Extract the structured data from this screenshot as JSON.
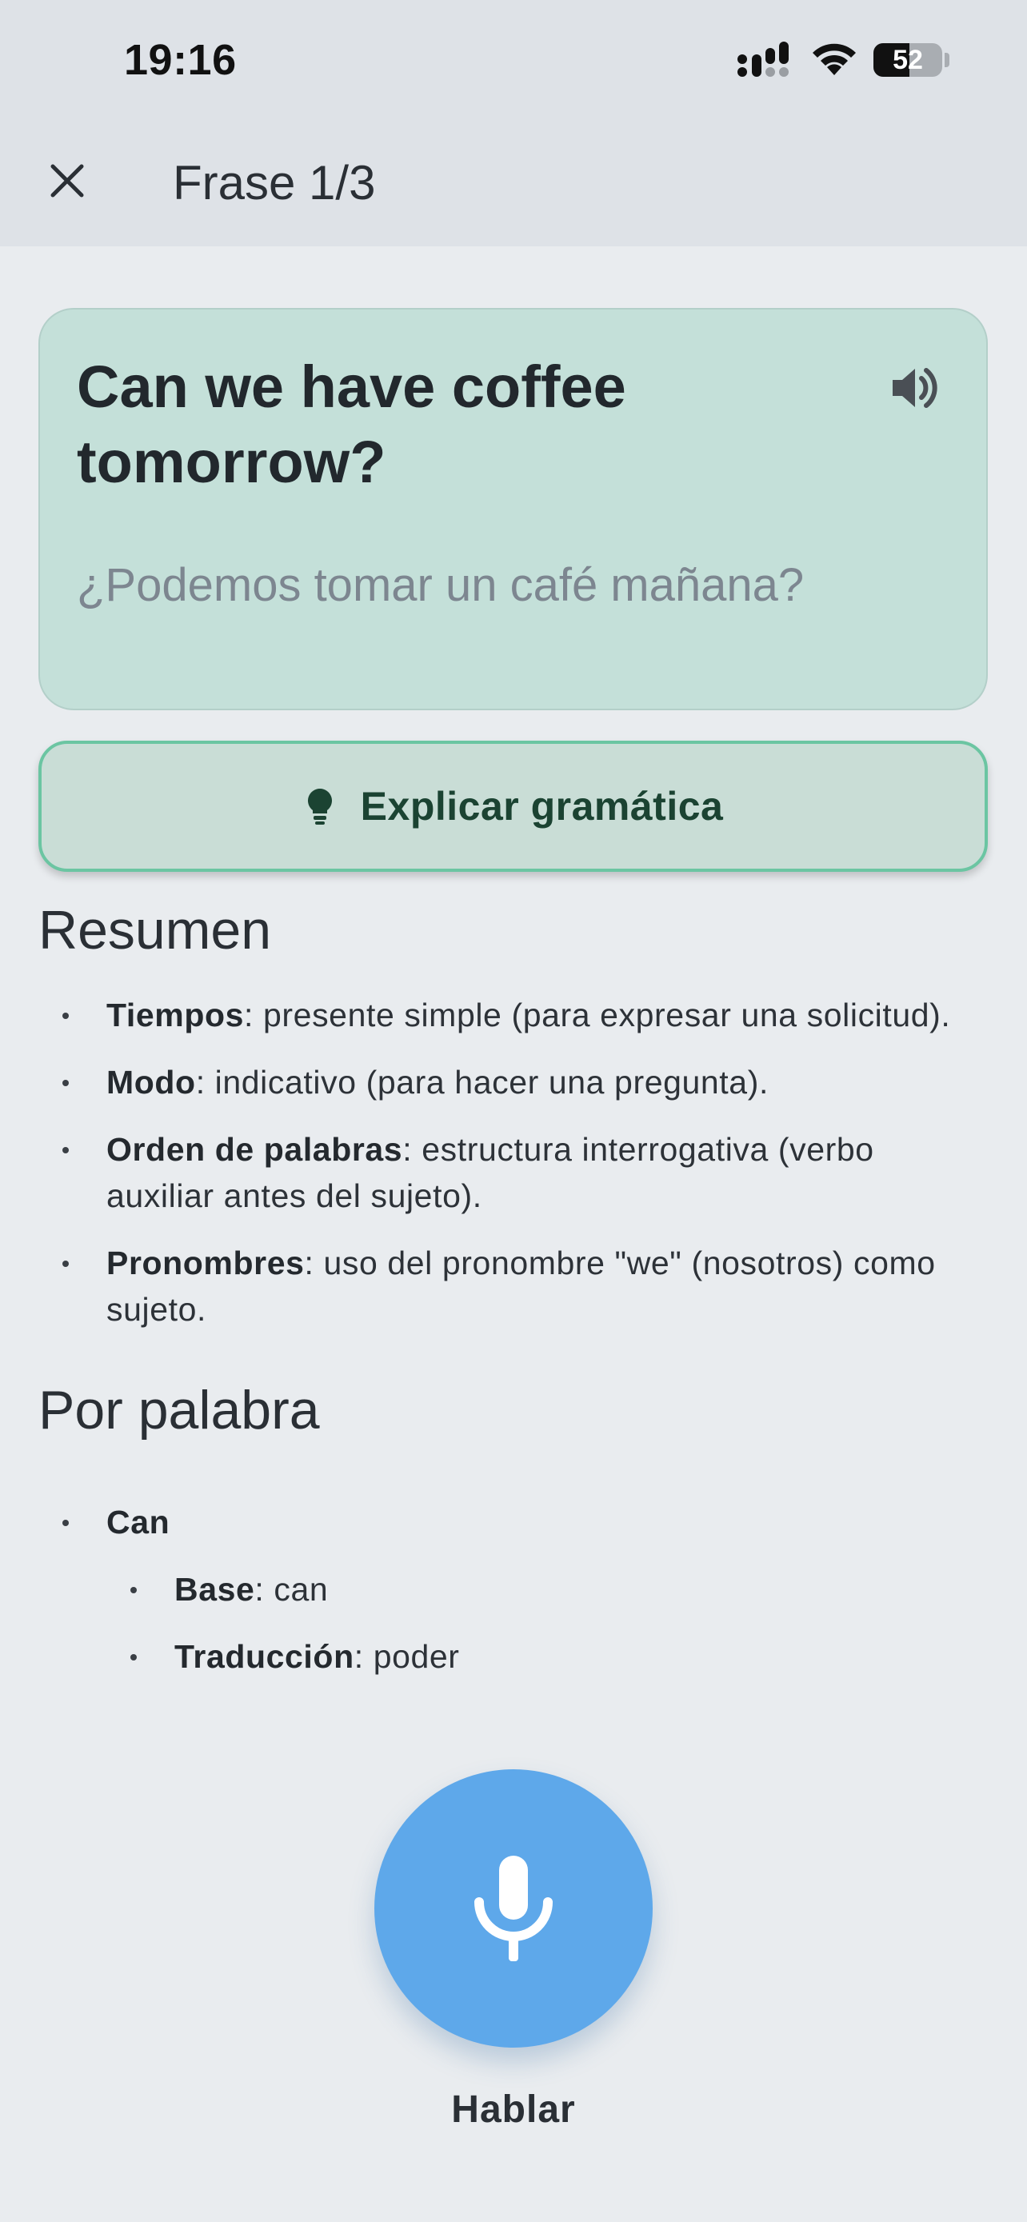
{
  "status_bar": {
    "time": "19:16",
    "battery": "52",
    "battery_level": 0.52,
    "icons": [
      "signal-icon",
      "wifi-icon",
      "battery-icon"
    ]
  },
  "header": {
    "close_icon": "close-icon",
    "title": "Frase 1/3"
  },
  "phrase": {
    "english": "Can we have coffee tomorrow?",
    "spanish": "¿Podemos tomar un café mañana?",
    "speaker_icon": "speaker-icon"
  },
  "explain_button": {
    "label": "Explicar gramática",
    "icon": "lightbulb-icon"
  },
  "summary": {
    "heading": "Resumen",
    "items": [
      {
        "term": "Tiempos",
        "text": ": presente simple (para expresar una solicitud)."
      },
      {
        "term": "Modo",
        "text": ": indicativo (para hacer una pregunta)."
      },
      {
        "term": "Orden de palabras",
        "text": ": estructura interrogativa (verbo auxiliar antes del sujeto)."
      },
      {
        "term": "Pronombres",
        "text": ": uso del pronombre \"we\" (nosotros) como sujeto."
      }
    ]
  },
  "by_word": {
    "heading": "Por palabra",
    "word": "Can",
    "details": [
      {
        "term": "Base",
        "text": ": can"
      },
      {
        "term": "Traducción",
        "text": ": poder"
      }
    ]
  },
  "mic": {
    "label": "Hablar",
    "icon": "microphone-icon"
  },
  "colors": {
    "background": "#e9ecef",
    "card": "#c4e0d9",
    "button_border": "#6bc5a2",
    "mic": "#5ea8ea"
  }
}
